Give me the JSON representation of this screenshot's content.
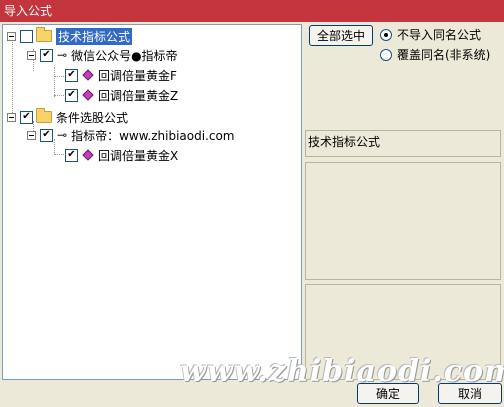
{
  "window": {
    "title": "导入公式"
  },
  "tree": {
    "root1": {
      "label": "技术指标公式",
      "checked": false
    },
    "group1": {
      "label": "微信公众号●指标帝",
      "checked": true
    },
    "item1": {
      "label": "回调倍量黄金F",
      "checked": true
    },
    "item2": {
      "label": "回调倍量黄金Z",
      "checked": true
    },
    "root2": {
      "label": "条件选股公式",
      "checked": true
    },
    "group2": {
      "label": "指标帝：www.zhibiaodi.com",
      "checked": true
    },
    "item3": {
      "label": "回调倍量黄金X",
      "checked": true
    }
  },
  "options": {
    "select_all_label": "全部选中",
    "radio_no_import_label": "不导入同名公式",
    "radio_overwrite_label": "覆盖同名(非系统)",
    "selected": "no_import"
  },
  "detail": {
    "title": "技术指标公式"
  },
  "footer": {
    "ok_label": "确定",
    "cancel_label": "取消"
  },
  "watermark": "www.zhibiaodi.com"
}
